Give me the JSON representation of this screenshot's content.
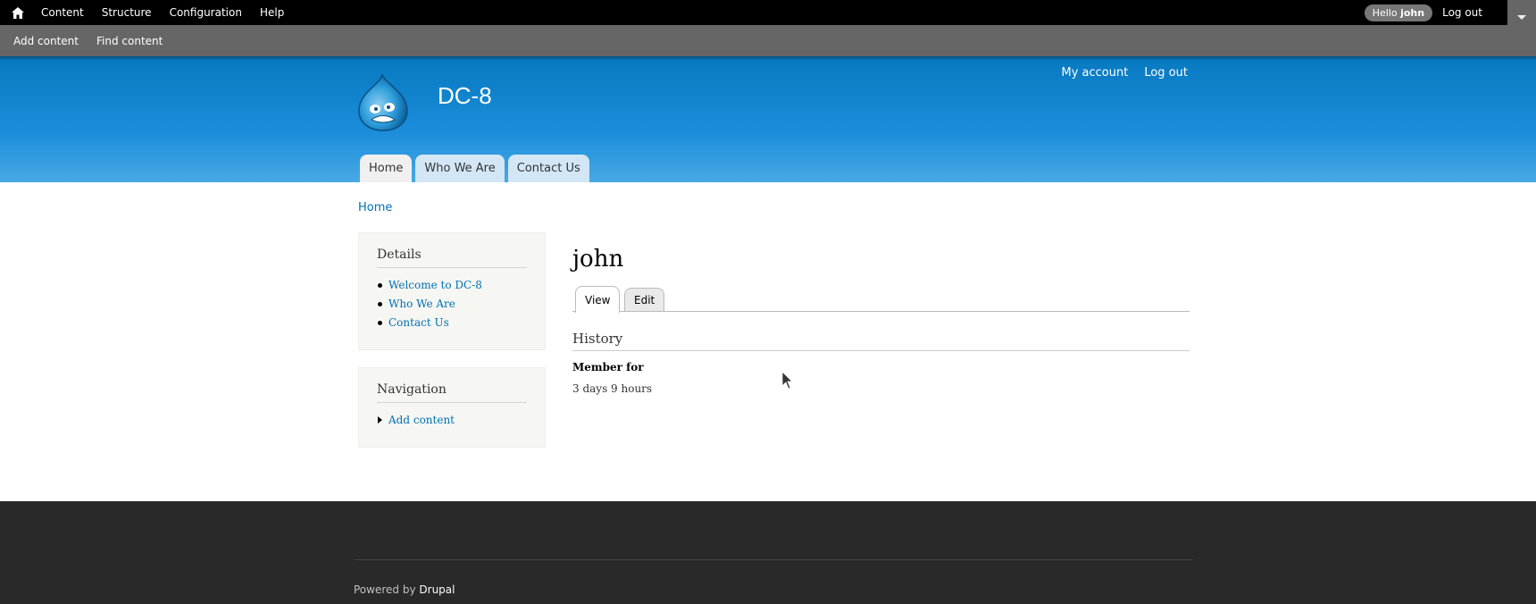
{
  "toolbar": {
    "menu": [
      "Content",
      "Structure",
      "Configuration",
      "Help"
    ],
    "hello_prefix": "Hello",
    "user": "john",
    "logout": "Log out"
  },
  "shortcuts": [
    "Add content",
    "Find content"
  ],
  "header": {
    "site_name": "DC-8",
    "secondary_menu": [
      "My account",
      "Log out"
    ],
    "main_menu": [
      "Home",
      "Who We Are",
      "Contact Us"
    ]
  },
  "breadcrumb": "Home",
  "sidebar": {
    "details": {
      "title": "Details",
      "links": [
        "Welcome to DC-8",
        "Who We Are",
        "Contact Us"
      ]
    },
    "navigation": {
      "title": "Navigation",
      "links": [
        "Add content"
      ]
    }
  },
  "content": {
    "title": "john",
    "tabs": [
      "View",
      "Edit"
    ],
    "section": "History",
    "member_label": "Member for",
    "member_value": "3 days 9 hours"
  },
  "footer": {
    "powered_prefix": "Powered by",
    "powered_link": "Drupal"
  },
  "colors": {
    "link": "#0071b3",
    "header_top": "#0779bf",
    "header_bottom": "#48a9e4",
    "footer_bg": "#292929"
  }
}
